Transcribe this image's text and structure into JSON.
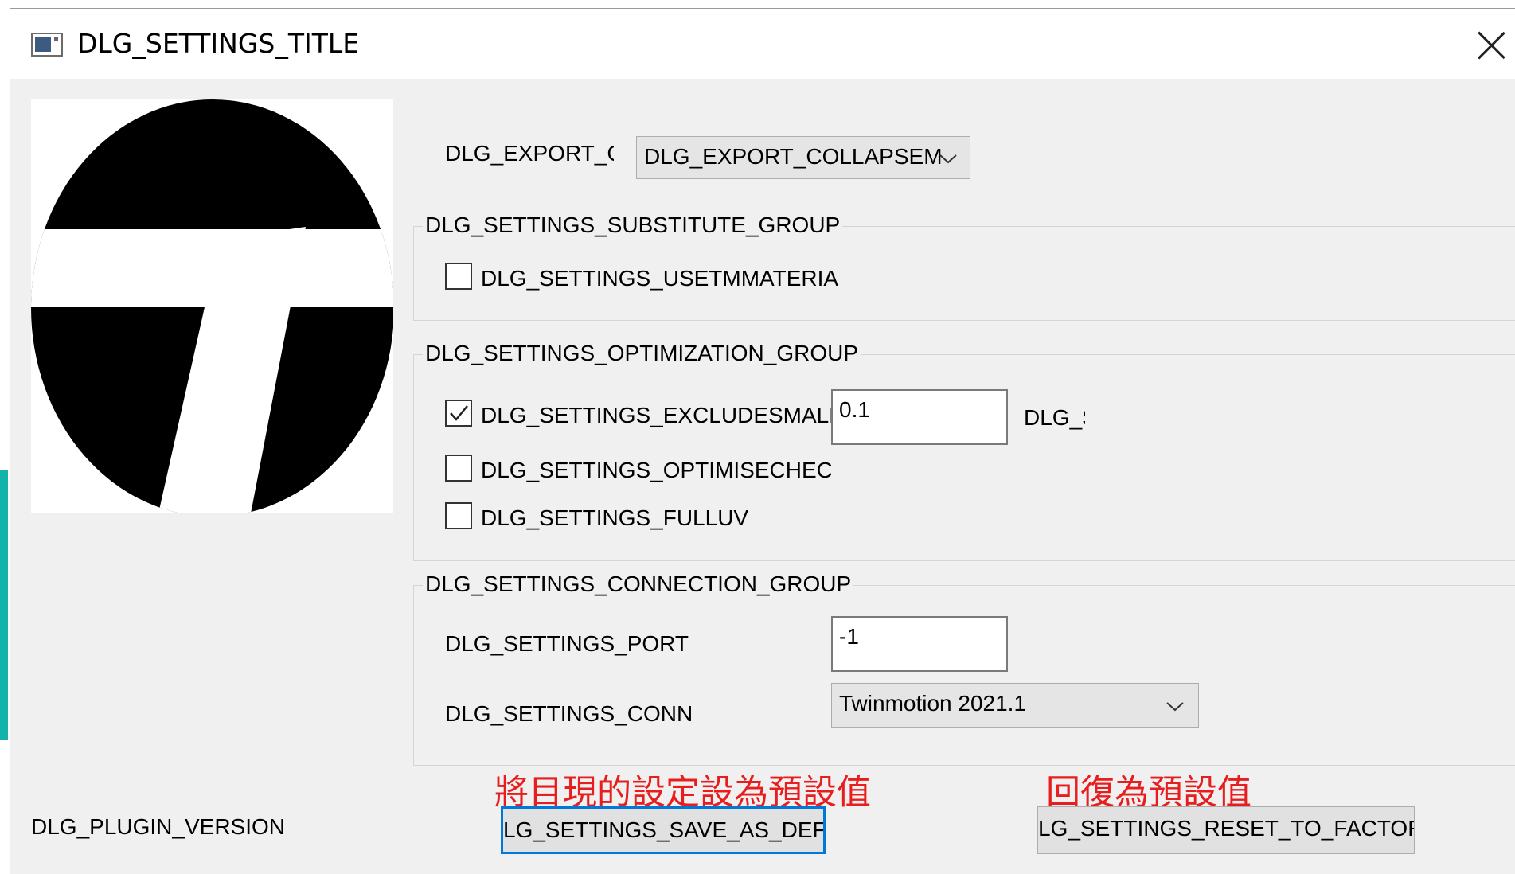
{
  "window": {
    "title": "DLG_SETTINGS_TITLE"
  },
  "export": {
    "label": "DLG_EXPORT_C",
    "combo_value": "DLG_EXPORT_COLLAPSEM"
  },
  "substitute_group": {
    "title": "DLG_SETTINGS_SUBSTITUTE_GROUP",
    "use_tm_materials": {
      "label": "DLG_SETTINGS_USETMMATERIA",
      "checked": false
    }
  },
  "optimization_group": {
    "title": "DLG_SETTINGS_OPTIMIZATION_GROUP",
    "exclude_small": {
      "label": "DLG_SETTINGS_EXCLUDESMALL(",
      "checked": true,
      "value": "0.1",
      "unit_label": "DLG_S"
    },
    "optimise_check": {
      "label": "DLG_SETTINGS_OPTIMISECHECK",
      "checked": false
    },
    "full_uv": {
      "label": "DLG_SETTINGS_FULLUV",
      "checked": false
    }
  },
  "connection_group": {
    "title": "DLG_SETTINGS_CONNECTION_GROUP",
    "port": {
      "label": "DLG_SETTINGS_PORT",
      "value": "-1"
    },
    "conn": {
      "label": "DLG_SETTINGS_CONN",
      "selected": "Twinmotion 2021.1"
    }
  },
  "footer": {
    "version_label": "DLG_PLUGIN_VERSION",
    "save_default_button": "LG_SETTINGS_SAVE_AS_DEFAU",
    "reset_factory_button": "LG_SETTINGS_RESET_TO_FACTOR"
  },
  "annotations": {
    "save_default_note": "將目現的設定設為預設值",
    "reset_note": "回復為預設值",
    "color": "#e81e1e"
  },
  "colors": {
    "accent": "#0078d7",
    "dialog_bg": "#f0f0f0",
    "teal_strip": "#12b3a8"
  }
}
